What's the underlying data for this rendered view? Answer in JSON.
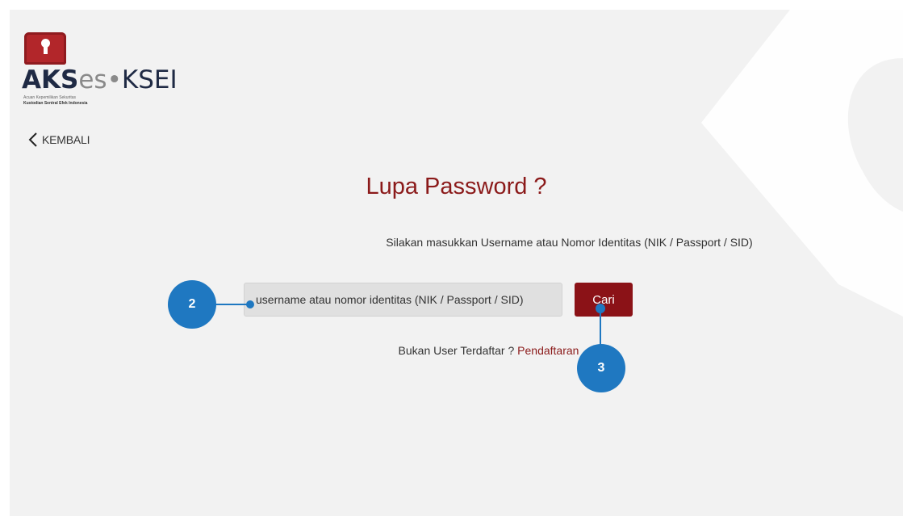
{
  "logo": {
    "name_part1": "AKS",
    "name_part2": "es",
    "separator": "•",
    "name_part3": "KSEI",
    "tagline1": "Acuan Kepemilikan Sekuritas",
    "tagline2": "Kustodian Sentral Efek Indonesia"
  },
  "nav": {
    "back_label": "KEMBALI"
  },
  "form": {
    "title": "Lupa Password ?",
    "instruction": "Silakan masukkan Username atau Nomor Identitas (NIK / Passport / SID)",
    "input_placeholder": "username atau nomor identitas (NIK / Passport / SID)",
    "submit_label": "Cari",
    "register_prompt": "Bukan User Terdaftar ? ",
    "register_link": "Pendaftaran"
  },
  "annotations": {
    "badge_2": "2",
    "badge_3": "3"
  },
  "colors": {
    "brand_red": "#8b1217",
    "title_red": "#8b1a1a",
    "callout_blue": "#1f78c1",
    "background": "#f2f2f2"
  }
}
